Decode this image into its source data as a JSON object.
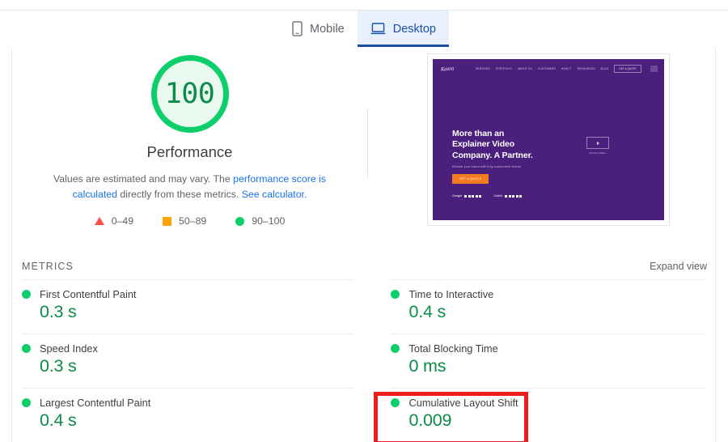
{
  "tabs": [
    {
      "label": "Mobile",
      "icon": "phone-icon",
      "active": false
    },
    {
      "label": "Desktop",
      "icon": "laptop-icon",
      "active": true
    }
  ],
  "score_panel": {
    "score": "100",
    "title": "Performance",
    "description_part1": "Values are estimated and may vary. The ",
    "description_link1": "performance score is calculated",
    "description_part2": " directly from these metrics. ",
    "description_link2": "See calculator.",
    "colors": {
      "good": "#0cce6b",
      "average": "#ffa400",
      "poor": "#ff4e42",
      "score_text": "#0b8c48"
    },
    "legend": [
      {
        "icon": "triangle-icon",
        "range": "0–49",
        "color": "#ff4e42"
      },
      {
        "icon": "square-icon",
        "range": "50–89",
        "color": "#ffa400"
      },
      {
        "icon": "circle-icon",
        "range": "90–100",
        "color": "#0cce6b"
      }
    ]
  },
  "thumbnail": {
    "brand": "Kasra",
    "nav_links": [
      "SERVICES",
      "PORTFOLIO",
      "ABOUT US",
      "CUSTOMERS",
      "HOW IT",
      "RESOURCES",
      "BLOG"
    ],
    "nav_cta": "GET A QUOTE",
    "headline_line1": "More than an",
    "headline_line2": "Explainer Video",
    "headline_line3": "Company. A Partner.",
    "subtitle": "Elevate your brand with fully customized videos",
    "cta_button": "GET A QUOTE",
    "play_label": "WATCH REEL",
    "ratings": [
      {
        "name": "Google",
        "stars": 5
      },
      {
        "name": "Clutch",
        "stars": 5
      }
    ],
    "background_color": "#4b1f7c",
    "cta_color": "#f47b20"
  },
  "metrics_section": {
    "label": "METRICS",
    "expand_view": "Expand view",
    "left_column": [
      {
        "name": "First Contentful Paint",
        "value": "0.3 s",
        "status": "good"
      },
      {
        "name": "Speed Index",
        "value": "0.3 s",
        "status": "good"
      },
      {
        "name": "Largest Contentful Paint",
        "value": "0.4 s",
        "status": "good"
      }
    ],
    "right_column": [
      {
        "name": "Time to Interactive",
        "value": "0.4 s",
        "status": "good"
      },
      {
        "name": "Total Blocking Time",
        "value": "0 ms",
        "status": "good"
      },
      {
        "name": "Cumulative Layout Shift",
        "value": "0.009",
        "status": "good",
        "highlighted": true
      }
    ]
  },
  "annotation": {
    "color": "#ee1c1c",
    "target": "Cumulative Layout Shift"
  }
}
